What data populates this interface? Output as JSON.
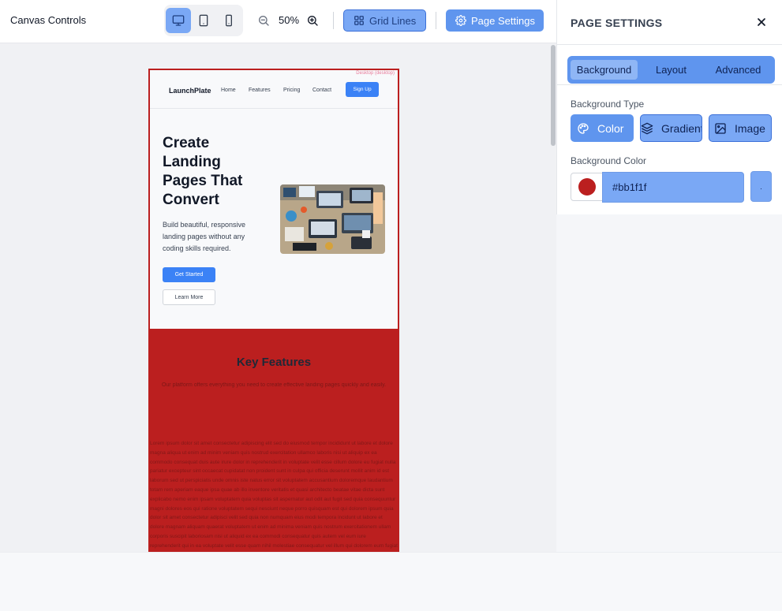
{
  "toolbar": {
    "title": "Canvas Controls",
    "devices": [
      {
        "name": "desktop",
        "icon": "monitor-icon",
        "active": true
      },
      {
        "name": "tablet",
        "icon": "tablet-icon",
        "active": false
      },
      {
        "name": "mobile",
        "icon": "smartphone-icon",
        "active": false
      }
    ],
    "zoom": "50%",
    "grid_lines_label": "Grid Lines",
    "page_settings_label": "Page Settings"
  },
  "preview": {
    "device_tag": "Desktop (desktop)",
    "background_color": "#bb1f1f",
    "brand": "LaunchPlate",
    "nav_links": [
      "Home",
      "Features",
      "Pricing",
      "Contact"
    ],
    "signup_label": "Sign Up",
    "hero_title": "Create Landing Pages That Convert",
    "hero_subtitle": "Build beautiful, responsive landing pages without any coding skills required.",
    "primary_cta": "Get Started",
    "secondary_cta": "Learn More",
    "hero_image_alt": "team-working-on-laptops",
    "features_title": "Key Features",
    "features_subtitle": "Our platform offers everything you need to create effective landing pages quickly and easily.",
    "lorem": "Lorem ipsum dolor sit amet consectetur adipiscing elit sed do eiusmod tempor incididunt ut labore et dolore magna aliqua ut enim ad minim veniam quis nostrud exercitation ullamco laboris nisi ut aliquip ex ea commodo consequat duis aute irure dolor in reprehenderit in voluptate velit esse cillum dolore eu fugiat nulla pariatur excepteur sint occaecat cupidatat non proident sunt in culpa qui officia deserunt mollit anim id est laborum sed ut perspiciatis unde omnis iste natus error sit voluptatem accusantium doloremque laudantium totam rem aperiam eaque ipsa quae ab illo inventore veritatis et quasi architecto beatae vitae dicta sunt explicabo nemo enim ipsam voluptatem quia voluptas sit aspernatur aut odit aut fugit sed quia consequuntur magni dolores eos qui ratione voluptatem sequi nesciunt neque porro quisquam est qui dolorem ipsum quia dolor sit amet consectetur adipisci velit sed quia non numquam eius modi tempora incidunt ut labore et dolore magnam aliquam quaerat voluptatem ut enim ad minima veniam quis nostrum exercitationem ullam corporis suscipit laboriosam nisi ut aliquid ex ea commodi consequatur quis autem vel eum iure reprehenderit qui in ea voluptate velit esse quam nihil molestiae consequatur vel illum qui dolorem eum fugiat quo voluptas nulla pariatur at vero eos et accusamus et iusto odio dignissimos ducimus qui blanditiis praesentium voluptatum deleniti atque corrupti quos dolores et quas molestias excepturi sint occaecati cupiditate non provident similique sunt in culpa qui officia deserunt mollitia animi id est laborum et dolorum fuga"
  },
  "panel": {
    "title": "PAGE SETTINGS",
    "tabs": [
      {
        "label": "Background",
        "active": true
      },
      {
        "label": "Layout",
        "active": false
      },
      {
        "label": "Advanced",
        "active": false
      }
    ],
    "background_type_label": "Background Type",
    "background_types": [
      {
        "label": "Color",
        "icon": "palette-icon",
        "active": true
      },
      {
        "label": "Gradient",
        "icon": "layers-icon",
        "active": false
      },
      {
        "label": "Image",
        "icon": "image-icon",
        "active": false
      }
    ],
    "background_color_label": "Background Color",
    "background_color_value": "#bb1f1f",
    "extra_button_label": "."
  }
}
